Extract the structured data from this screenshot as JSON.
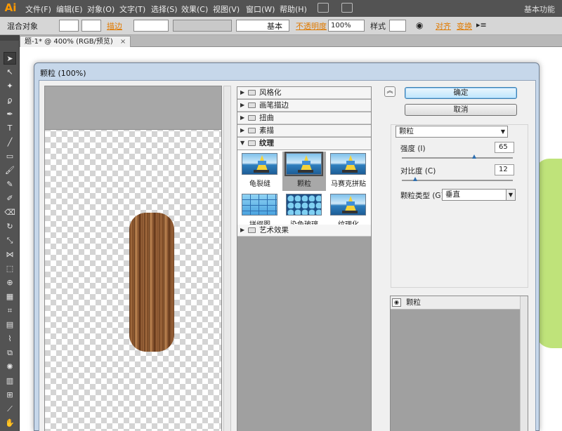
{
  "app": {
    "logo": "Ai",
    "workspace": "基本功能"
  },
  "menu": [
    "文件(F)",
    "编辑(E)",
    "对象(O)",
    "文字(T)",
    "选择(S)",
    "效果(C)",
    "视图(V)",
    "窗口(W)",
    "帮助(H)"
  ],
  "control_bar": {
    "object_type": "混合对象",
    "stroke_label": "描边",
    "brush_label": "基本",
    "opacity_label": "不透明度",
    "opacity_value": "100%",
    "style_label": "样式",
    "align_label": "对齐",
    "transform_label": "变换"
  },
  "document_tab": {
    "title": "题-1* @ 400% (RGB/预览)",
    "close": "×"
  },
  "dialog": {
    "title": "颗粒 (100%)",
    "ok": "确定",
    "cancel": "取消",
    "collapse_icon": "collapse-icon",
    "categories": [
      {
        "label": "风格化",
        "expanded": false
      },
      {
        "label": "画笔描边",
        "expanded": false
      },
      {
        "label": "扭曲",
        "expanded": false
      },
      {
        "label": "素描",
        "expanded": false
      },
      {
        "label": "纹理",
        "expanded": true
      },
      {
        "label": "艺术效果",
        "expanded": false
      }
    ],
    "texture_filters": [
      {
        "label": "龟裂缝",
        "selected": false
      },
      {
        "label": "颗粒",
        "selected": true
      },
      {
        "label": "马赛克拼贴",
        "selected": false
      },
      {
        "label": "拼缀图",
        "selected": false
      },
      {
        "label": "染色玻璃",
        "selected": false
      },
      {
        "label": "纹理化",
        "selected": false
      }
    ],
    "selected_filter": "颗粒",
    "params": {
      "intensity_label": "强度 (I)",
      "intensity_value": "65",
      "contrast_label": "对比度 (C)",
      "contrast_value": "12",
      "grain_type_label": "颗粒类型 (G):",
      "grain_type_value": "垂直"
    },
    "intensity_fraction": 0.65,
    "contrast_fraction": 0.12,
    "effect_layer": "颗粒"
  },
  "colors": {
    "app_orange": "#ff9a00",
    "ok_button": "#bee6fd",
    "wood": "#8a5630",
    "canvas_green": "#bfe37a"
  }
}
